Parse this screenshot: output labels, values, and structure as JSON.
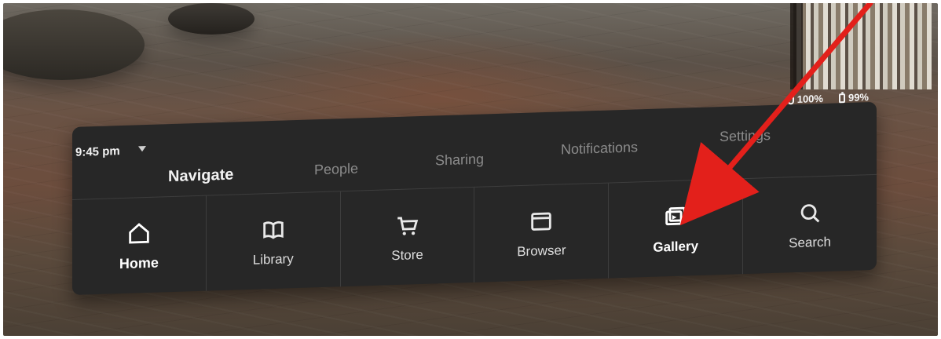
{
  "status_bar": {
    "time": "9:45 pm",
    "controller_percent": "100%",
    "headset_battery_percent": "99%"
  },
  "tabs": [
    {
      "label": "Navigate",
      "active": true
    },
    {
      "label": "People",
      "active": false
    },
    {
      "label": "Sharing",
      "active": false
    },
    {
      "label": "Notifications",
      "active": false
    },
    {
      "label": "Settings",
      "active": false
    }
  ],
  "nav": [
    {
      "label": "Home",
      "icon": "home-icon",
      "active": true
    },
    {
      "label": "Library",
      "icon": "book-icon",
      "active": false
    },
    {
      "label": "Store",
      "icon": "cart-icon",
      "active": false
    },
    {
      "label": "Browser",
      "icon": "browser-window-icon",
      "active": false
    },
    {
      "label": "Gallery",
      "icon": "gallery-icon",
      "active": false
    },
    {
      "label": "Search",
      "icon": "search-icon",
      "active": false
    }
  ],
  "overlay": {
    "arrow_color": "#e3201b"
  }
}
